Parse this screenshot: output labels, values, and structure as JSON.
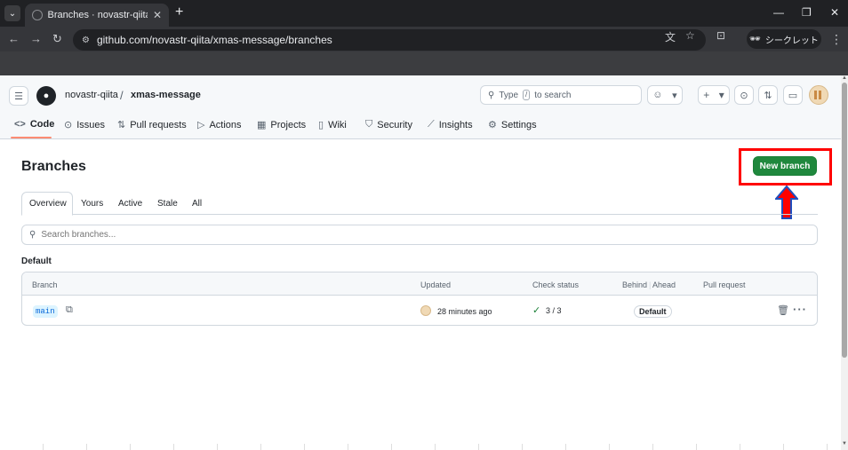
{
  "browser": {
    "tab_title": "Branches · novastr-qiita/xmas-message",
    "tab_close": "✕",
    "new_tab": "+",
    "url": "github.com/novastr-qiita/xmas-message/branches",
    "incognito_label": "シークレット",
    "window_controls": {
      "minimize": "—",
      "maximize": "❐",
      "close": "✕"
    }
  },
  "github": {
    "owner": "novastr-qiita",
    "separator": "/",
    "repo": "xmas-message",
    "search_prefix": "Type",
    "search_key": "/",
    "search_suffix": "to search",
    "nav_tabs": [
      {
        "label": "Code",
        "icon": "code-icon"
      },
      {
        "label": "Issues",
        "icon": "issue-icon"
      },
      {
        "label": "Pull requests",
        "icon": "pull-request-icon"
      },
      {
        "label": "Actions",
        "icon": "play-icon"
      },
      {
        "label": "Projects",
        "icon": "table-icon"
      },
      {
        "label": "Wiki",
        "icon": "book-icon"
      },
      {
        "label": "Security",
        "icon": "shield-icon"
      },
      {
        "label": "Insights",
        "icon": "graph-icon"
      },
      {
        "label": "Settings",
        "icon": "gear-icon"
      }
    ]
  },
  "page": {
    "title": "Branches",
    "new_branch_label": "New branch",
    "sub_tabs": [
      "Overview",
      "Yours",
      "Active",
      "Stale",
      "All"
    ],
    "search_placeholder": "Search branches...",
    "section_label": "Default",
    "table": {
      "headers": {
        "branch": "Branch",
        "updated": "Updated",
        "check_status": "Check status",
        "behind": "Behind",
        "ahead": "Ahead",
        "pull_request": "Pull request"
      },
      "rows": [
        {
          "branch": "main",
          "updated": "28 minutes ago",
          "check_status": "3 / 3",
          "badge": "Default"
        }
      ]
    }
  },
  "colors": {
    "accent_green": "#1f883d",
    "highlight_red": "#ff0000",
    "arrow_blue": "#1f4fbf",
    "tab_underline": "#fd8c73"
  }
}
